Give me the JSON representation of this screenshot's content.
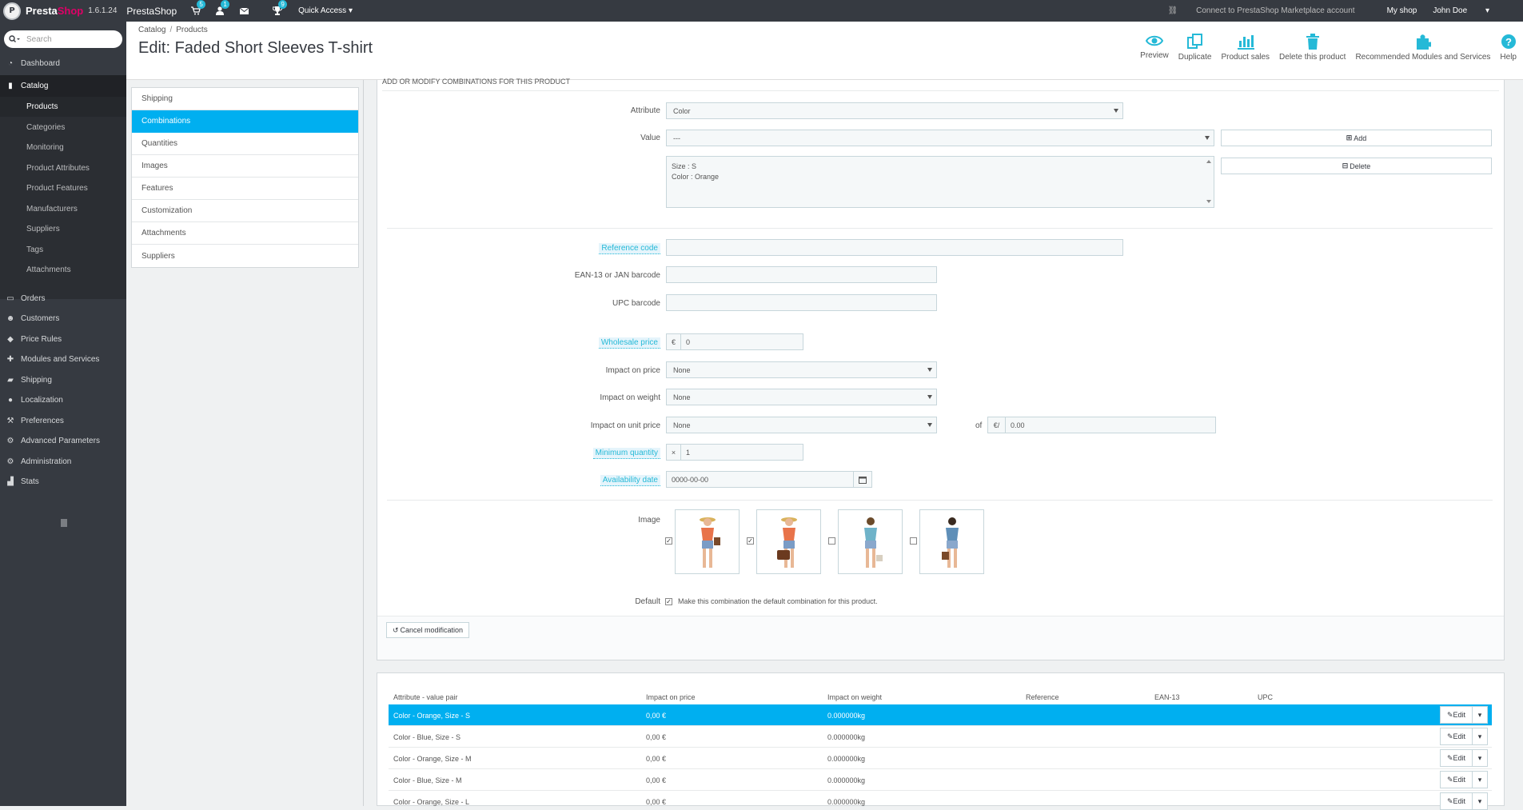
{
  "topbar": {
    "version": "1.6.1.24",
    "store_name": "PrestaShop",
    "badges": {
      "orders": "5",
      "customers": "1",
      "messages": "",
      "notifications": "9"
    },
    "quick_access": "Quick Access",
    "connect": "Connect to PrestaShop Marketplace account",
    "my_shop": "My shop",
    "user": "John Doe"
  },
  "sidebar": {
    "search_placeholder": "Search",
    "items": [
      {
        "label": "Dashboard",
        "icon": "dashboard-icon"
      },
      {
        "label": "Catalog",
        "icon": "book-icon"
      },
      {
        "label": "Orders",
        "icon": "credit-card-icon"
      },
      {
        "label": "Customers",
        "icon": "users-icon"
      },
      {
        "label": "Price Rules",
        "icon": "tag-icon"
      },
      {
        "label": "Modules and Services",
        "icon": "puzzle-icon"
      },
      {
        "label": "Shipping",
        "icon": "truck-icon"
      },
      {
        "label": "Localization",
        "icon": "globe-icon"
      },
      {
        "label": "Preferences",
        "icon": "wrench-icon"
      },
      {
        "label": "Advanced Parameters",
        "icon": "cogs-icon"
      },
      {
        "label": "Administration",
        "icon": "cog-icon"
      },
      {
        "label": "Stats",
        "icon": "bar-chart-icon"
      }
    ],
    "catalog_sub": [
      "Products",
      "Categories",
      "Monitoring",
      "Product Attributes",
      "Product Features",
      "Manufacturers",
      "Suppliers",
      "Tags",
      "Attachments"
    ]
  },
  "header": {
    "breadcrumb": [
      "Catalog",
      "Products"
    ],
    "title": "Edit: Faded Short Sleeves T-shirt",
    "toolbar": [
      "Preview",
      "Duplicate",
      "Product sales",
      "Delete this product",
      "Recommended Modules and Services",
      "Help"
    ]
  },
  "tabs": [
    "Shipping",
    "Combinations",
    "Quantities",
    "Images",
    "Features",
    "Customization",
    "Attachments",
    "Suppliers"
  ],
  "form": {
    "section_title": "Add or modify combinations for this product",
    "attribute_label": "Attribute",
    "attribute_value": "Color",
    "value_label": "Value",
    "value_value": "---",
    "add_button": "Add",
    "delete_button": "Delete",
    "combination_list": [
      "Size : S",
      "Color : Orange"
    ],
    "reference_label": "Reference code",
    "reference_value": "",
    "ean_label": "EAN-13 or JAN barcode",
    "ean_value": "",
    "upc_label": "UPC barcode",
    "upc_value": "",
    "wholesale_label": "Wholesale price",
    "currency": "€",
    "wholesale_value": "0",
    "impact_price_label": "Impact on price",
    "impact_price_value": "None",
    "impact_weight_label": "Impact on weight",
    "impact_weight_value": "None",
    "impact_unit_label": "Impact on unit price",
    "impact_unit_value": "None",
    "of_label": "of",
    "unit_prefix": "€/",
    "unit_value": "0.00",
    "min_qty_label": "Minimum quantity",
    "min_qty_prefix": "×",
    "min_qty_value": "1",
    "availability_label": "Availability date",
    "availability_value": "0000-00-00",
    "image_label": "Image",
    "images_checked": [
      true,
      true,
      false,
      false
    ],
    "default_label": "Default",
    "default_text": "Make this combination the default combination for this product.",
    "cancel_button": "Cancel modification"
  },
  "table": {
    "headers": [
      "Attribute - value pair",
      "Impact on price",
      "Impact on weight",
      "Reference",
      "EAN-13",
      "UPC"
    ],
    "edit_label": "Edit",
    "rows": [
      {
        "pair": "Color - Orange, Size - S",
        "price": "0,00 €",
        "weight": "0.000000kg"
      },
      {
        "pair": "Color - Blue, Size - S",
        "price": "0,00 €",
        "weight": "0.000000kg"
      },
      {
        "pair": "Color - Orange, Size - M",
        "price": "0,00 €",
        "weight": "0.000000kg"
      },
      {
        "pair": "Color - Blue, Size - M",
        "price": "0,00 €",
        "weight": "0.000000kg"
      },
      {
        "pair": "Color - Orange, Size - L",
        "price": "0,00 €",
        "weight": "0.000000kg"
      }
    ]
  },
  "colors": {
    "accent": "#00aff0",
    "topbar": "#363a41",
    "brand_pink": "#df0067"
  }
}
